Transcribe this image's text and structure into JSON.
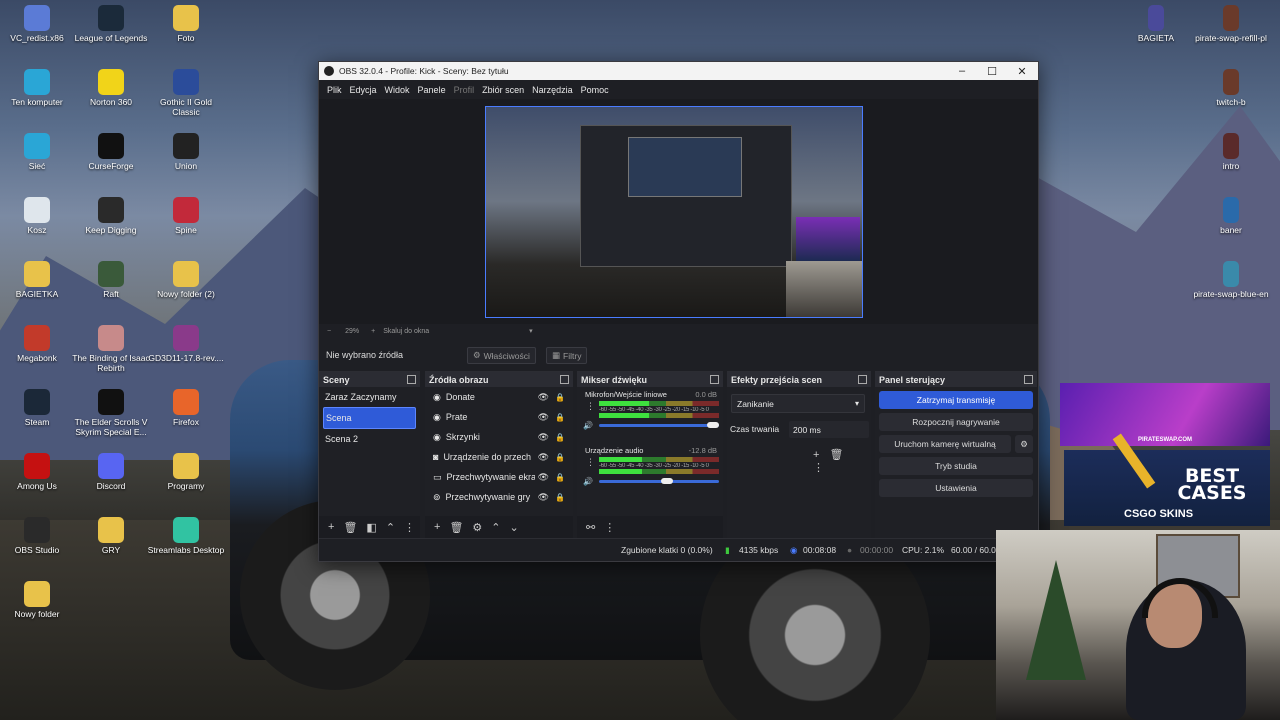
{
  "desktop_icons_left": [
    {
      "label": "VC_redist.x86",
      "icon": "installer-icon",
      "color": "#5b7bd6"
    },
    {
      "label": "League of Legends",
      "icon": "lol-icon",
      "color": "#1b2a3a"
    },
    {
      "label": "Foto",
      "icon": "folder-icon",
      "color": "#e8c24a"
    },
    {
      "label": "Ten komputer",
      "icon": "computer-icon",
      "color": "#2aa6d6"
    },
    {
      "label": "Norton 360",
      "icon": "norton-icon",
      "color": "#f1d419"
    },
    {
      "label": "Gothic II Gold Classic",
      "icon": "gothic-icon",
      "color": "#2b4c9a"
    },
    {
      "label": "Sieć",
      "icon": "network-icon",
      "color": "#2aa6d6"
    },
    {
      "label": "CurseForge",
      "icon": "curseforge-icon",
      "color": "#111111"
    },
    {
      "label": "Union",
      "icon": "union-icon",
      "color": "#222222"
    },
    {
      "label": "Kosz",
      "icon": "recycle-bin-icon",
      "color": "#dfe6ec"
    },
    {
      "label": "Keep Digging",
      "icon": "pickaxe-icon",
      "color": "#2a2a2a"
    },
    {
      "label": "Spine",
      "icon": "spine-icon",
      "color": "#c2293a"
    },
    {
      "label": "BAGIETKA",
      "icon": "folder-icon",
      "color": "#e8c24a"
    },
    {
      "label": "Raft",
      "icon": "raft-icon",
      "color": "#3a5a3a"
    },
    {
      "label": "Nowy folder (2)",
      "icon": "folder-icon",
      "color": "#e8c24a"
    },
    {
      "label": "Megabonk",
      "icon": "megabonk-icon",
      "color": "#c23a2a"
    },
    {
      "label": "The Binding of Isaac Rebirth",
      "icon": "isaac-icon",
      "color": "#c78a8a"
    },
    {
      "label": "GD3D11-17.8-rev....",
      "icon": "archive-icon",
      "color": "#8a3a8a"
    },
    {
      "label": "Steam",
      "icon": "steam-icon",
      "color": "#1b2838"
    },
    {
      "label": "The Elder Scrolls V Skyrim Special E...",
      "icon": "skyrim-icon",
      "color": "#111111"
    },
    {
      "label": "Firefox",
      "icon": "firefox-icon",
      "color": "#e8652a"
    },
    {
      "label": "Among Us",
      "icon": "among-us-icon",
      "color": "#c51111"
    },
    {
      "label": "Discord",
      "icon": "discord-icon",
      "color": "#5865f2"
    },
    {
      "label": "Programy",
      "icon": "folder-icon",
      "color": "#e8c24a"
    },
    {
      "label": "OBS Studio",
      "icon": "obs-icon",
      "color": "#2a2a2a"
    },
    {
      "label": "GRY",
      "icon": "folder-icon",
      "color": "#e8c24a"
    },
    {
      "label": "Streamlabs Desktop",
      "icon": "streamlabs-icon",
      "color": "#31c3a2"
    },
    {
      "label": "Nowy folder",
      "icon": "folder-icon",
      "color": "#e8c24a"
    }
  ],
  "desktop_icons_right": [
    {
      "label": "BAGIETA",
      "icon": "file-icon",
      "color": "#4a4a9a"
    },
    {
      "label": "pirate-swap-refill-pl",
      "icon": "file-icon",
      "color": "#6a3a2a"
    },
    {
      "label": "twitch-b",
      "icon": "file-icon",
      "color": "#6a3a2a"
    },
    {
      "label": "intro",
      "icon": "file-icon",
      "color": "#5a2a2a"
    },
    {
      "label": "baner",
      "icon": "file-icon",
      "color": "#2a6aaa"
    },
    {
      "label": "pirate-swap-blue-en",
      "icon": "file-icon",
      "color": "#3a8aaa"
    }
  ],
  "obs": {
    "title": "OBS 32.0.4 - Profile: Kick - Sceny: Bez tytułu",
    "menu": [
      "Plik",
      "Edycja",
      "Widok",
      "Panele",
      "Profil",
      "Zbiór scen",
      "Narzędzia",
      "Pomoc"
    ],
    "menu_disabled_index": 4,
    "zoom_minus": "−",
    "zoom_level": "29%",
    "zoom_plus": "+",
    "zoom_mode": "Skaluj do okna",
    "no_source": "Nie wybrano źródła",
    "properties_btn": "Właściwości",
    "filters_btn": "Filtry",
    "docks": {
      "scenes": {
        "title": "Sceny",
        "items": [
          "Zaraz Zaczynamy",
          "Scena",
          "Scena 2"
        ],
        "selected": 1
      },
      "sources": {
        "title": "Źródła obrazu",
        "items": [
          "Donate",
          "Prate",
          "Skrzynki",
          "Urządzenie do przechwytywania",
          "Przechwytywanie ekranu",
          "Przechwytywanie gry"
        ]
      },
      "mixer": {
        "title": "Mikser dźwięku",
        "channels": [
          {
            "name": "Mikrofon/Wejście liniowe",
            "db": "0.0 dB",
            "level": 0.42,
            "volume": 1.0
          },
          {
            "name": "Urządzenie audio",
            "db": "-12.8 dB",
            "level": 0.36,
            "volume": 0.62
          }
        ],
        "ticks": "-60 -55 -50 -45 -40 -35 -30 -25 -20 -15 -10 -5 0"
      },
      "transitions": {
        "title": "Efekty przejścia scen",
        "selected": "Zanikanie",
        "duration_label": "Czas trwania",
        "duration_value": "200 ms"
      },
      "controls": {
        "title": "Panel sterujący",
        "buttons": [
          "Zatrzymaj transmisję",
          "Rozpocznij nagrywanie",
          "Uruchom kamerę wirtualną",
          "Tryb studia",
          "Ustawienia"
        ]
      }
    },
    "status": {
      "dropped_frames": "Zgubione klatki 0 (0.0%)",
      "bitrate": "4135 kbps",
      "stream_time": "00:08:08",
      "rec_time": "00:00:00",
      "cpu": "CPU: 2.1%",
      "fps": "60.00 / 60.00 FPS"
    }
  },
  "ad": {
    "brand_top": "PIRATESWAP.COM",
    "best_cases": "BEST CASES",
    "skins": "CSGO SKINS"
  }
}
